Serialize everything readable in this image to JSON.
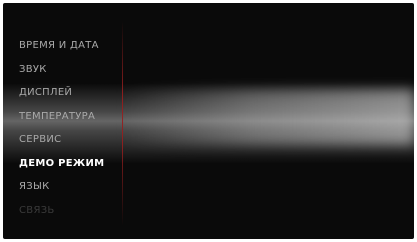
{
  "menu": {
    "items": [
      {
        "label": "ВРЕМЯ И ДАТА"
      },
      {
        "label": "ЗВУК"
      },
      {
        "label": "ДИСПЛЕЙ"
      },
      {
        "label": "ТЕМПЕРАТУРА"
      },
      {
        "label": "СЕРВИС"
      },
      {
        "label": "ДЕМО РЕЖИМ"
      },
      {
        "label": "ЯЗЫК"
      },
      {
        "label": "СВЯЗЬ"
      }
    ],
    "selected": "ДЕМО РЕЖИМ"
  },
  "colors": {
    "background": "#0a0a0a",
    "item_text": "#a9a9a9",
    "selected_text": "#ffffff",
    "divider": "#961e1e"
  }
}
